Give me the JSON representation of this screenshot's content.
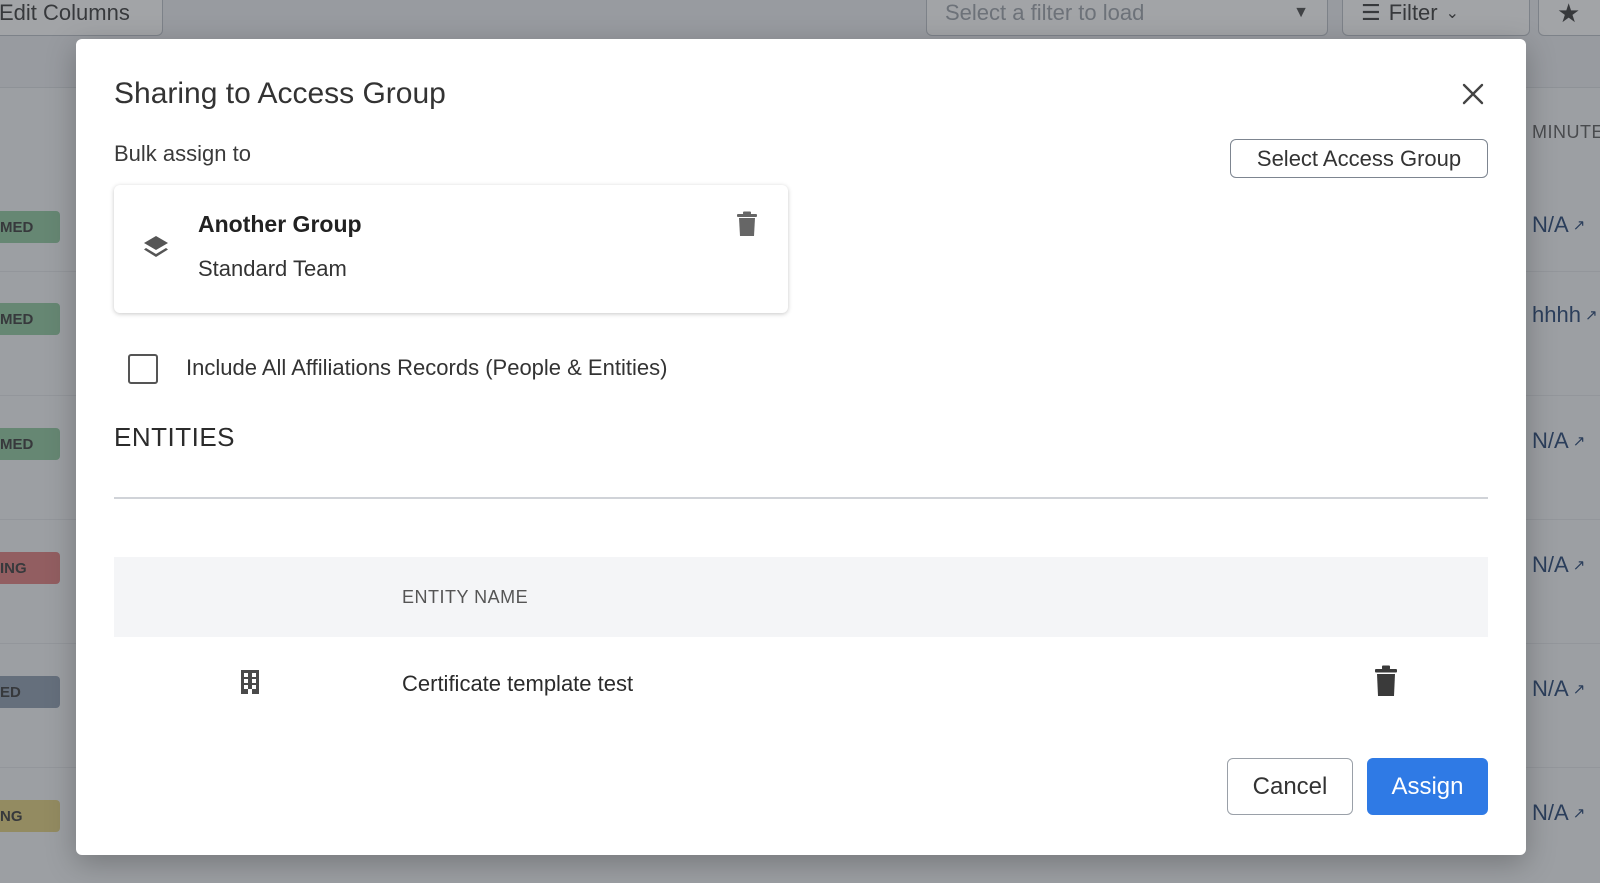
{
  "background": {
    "toolbar": {
      "edit_columns_label": "Edit Columns",
      "filter_select_placeholder": "Select a filter to load",
      "filter_label": "Filter"
    },
    "column_header": "MINUTE",
    "rows": [
      {
        "badge": "MED",
        "badge_color": "#8cc79b",
        "value": "N/A"
      },
      {
        "badge": "MED",
        "badge_color": "#8cc79b",
        "value": "hhhh"
      },
      {
        "badge": "MED",
        "badge_color": "#8cc79b",
        "value": "N/A"
      },
      {
        "badge": "ING",
        "badge_color": "#e07a7a",
        "value": "N/A"
      },
      {
        "badge": "ED",
        "badge_color": "#8b99ad",
        "value": "N/A"
      },
      {
        "badge": "NG",
        "badge_color": "#e2cf7a",
        "value": "N/A"
      }
    ]
  },
  "modal": {
    "title": "Sharing to Access Group",
    "bulk_assign_label": "Bulk assign to",
    "select_group_button": "Select Access Group",
    "group_card": {
      "name": "Another Group",
      "subtitle": "Standard Team",
      "icon": "layers-icon"
    },
    "include_affiliations": {
      "label": "Include All Affiliations Records (People & Entities)",
      "checked": false
    },
    "section_title": "ENTITIES",
    "table": {
      "columns": [
        "",
        "ENTITY NAME",
        ""
      ],
      "rows": [
        {
          "icon": "building-icon",
          "entity_name": "Certificate template test"
        }
      ]
    },
    "cancel_label": "Cancel",
    "assign_label": "Assign",
    "accent_color": "#2f7ae5"
  }
}
